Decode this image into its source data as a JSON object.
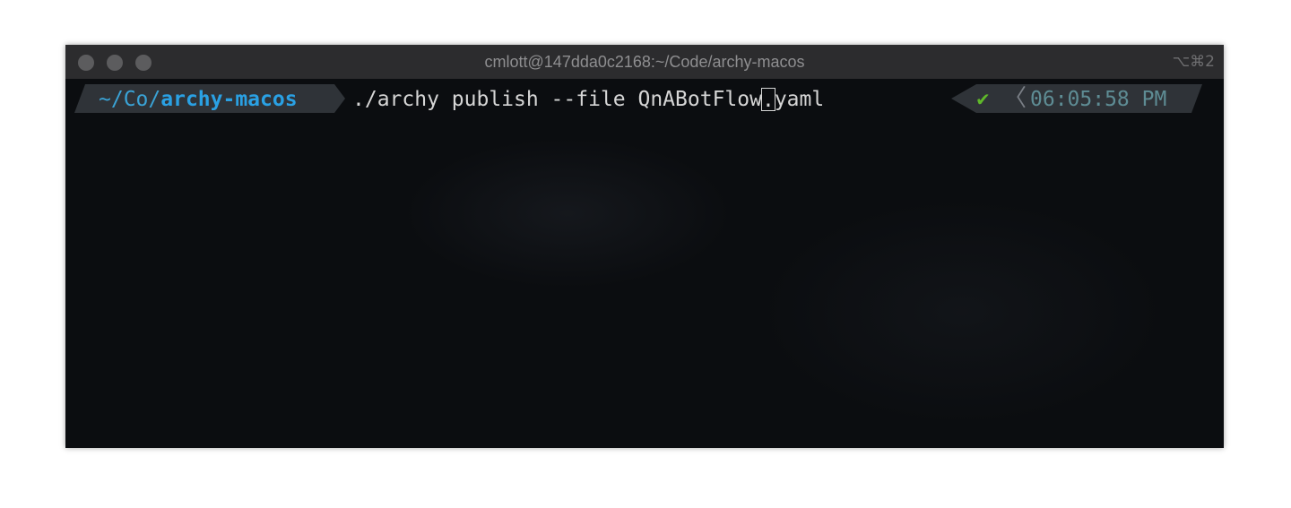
{
  "window": {
    "title": "cmlott@147dda0c2168:~/Code/archy-macos",
    "shortcut": "⌥⌘2"
  },
  "prompt": {
    "path_prefix": "~/Co/",
    "path_dir": "archy-macos",
    "command_before_cursor": "./archy publish --file QnABotFlow",
    "cursor_char": ".",
    "command_after_cursor": "yaml",
    "status_icon": "check-icon",
    "status_symbol": "✔",
    "separator": "〈",
    "time": "06:05:58 PM"
  },
  "colors": {
    "path": "#3aa3d6",
    "status_ok": "#5fb82a",
    "time": "#5e8c94",
    "background": "#0b0d10"
  }
}
